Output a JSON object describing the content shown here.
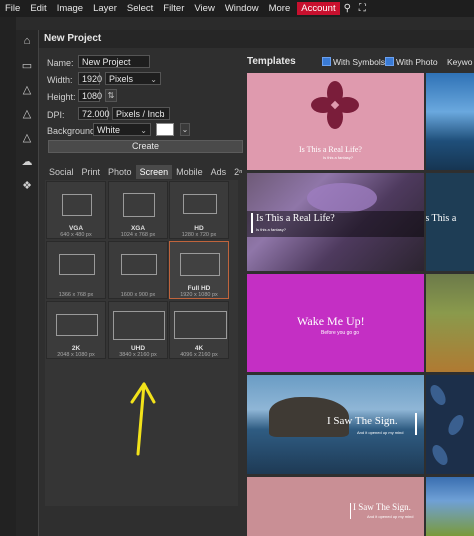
{
  "menu": {
    "items": [
      "File",
      "Edit",
      "Image",
      "Layer",
      "Select",
      "Filter",
      "View",
      "Window",
      "More"
    ],
    "account": "Account"
  },
  "dialog": {
    "title": "New Project",
    "name_label": "Name:",
    "name_value": "New Project",
    "width_label": "Width:",
    "width_value": "1920",
    "width_unit": "Pixels",
    "height_label": "Height:",
    "height_value": "1080",
    "swap_icon": "⇅",
    "dpi_label": "DPI:",
    "dpi_value": "72.000",
    "dpi_unit": "Pixels / Inch",
    "background_label": "Background:",
    "background_value": "White",
    "background_color": "#ffffff",
    "create_label": "Create",
    "tabs": [
      "Social",
      "Print",
      "Photo",
      "Screen",
      "Mobile",
      "Ads",
      "2ⁿ"
    ],
    "active_tab": "Screen"
  },
  "presets": [
    {
      "name": "VGA",
      "size": "640 x 480 px"
    },
    {
      "name": "XGA",
      "size": "1024 x 768 px"
    },
    {
      "name": "HD",
      "size": "1280 x 720 px"
    },
    {
      "name": "",
      "size": "1366 x 768 px"
    },
    {
      "name": "",
      "size": "1600 x 900 px"
    },
    {
      "name": "Full HD",
      "size": "1920 x 1080 px"
    },
    {
      "name": "2K",
      "size": "2048 x 1080 px"
    },
    {
      "name": "UHD",
      "size": "3840 x 2160 px"
    },
    {
      "name": "4K",
      "size": "4096 x 2160 px"
    }
  ],
  "templates": {
    "title": "Templates",
    "with_symbols": "With Symbols",
    "with_photo": "With Photo",
    "keywords": "Keywo",
    "cards": [
      {
        "title": "Is This a Real Life?",
        "sub": "Is this a fantasy?"
      },
      {
        "title": "Is This a Real Life?",
        "sub": "Is this a fantasy?"
      },
      {
        "title": "Is This a",
        "sub": ""
      },
      {
        "title": "Wake Me Up!",
        "sub": "Before you go go"
      },
      {
        "title": "I Saw The Sign.",
        "sub": "And it opened up my mind"
      },
      {
        "title": "I Saw The Sign.",
        "sub": "And it opened up my mind"
      }
    ]
  }
}
